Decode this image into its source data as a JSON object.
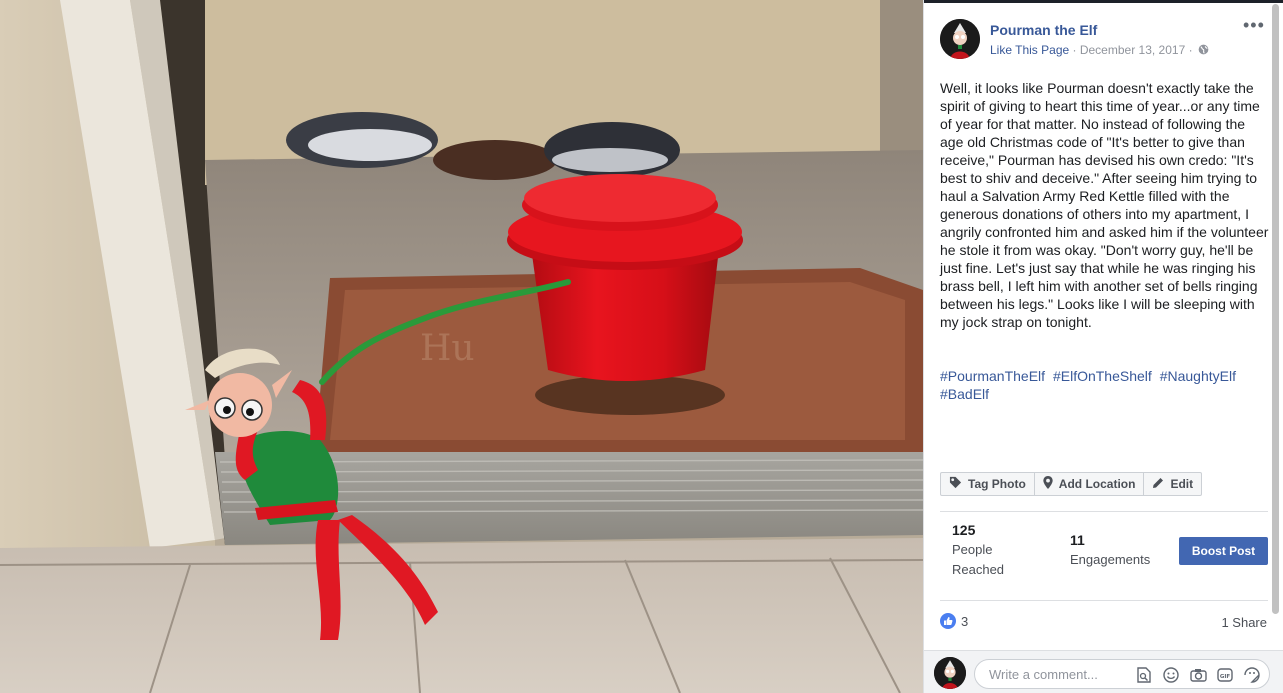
{
  "post": {
    "page_name": "Pourman the Elf",
    "like_page": "Like This Page",
    "separator": " · ",
    "date": "December 13, 2017",
    "date_suffix": " · ",
    "more": "•••",
    "text": "Well, it looks like Pourman doesn't exactly take the spirit of giving to heart this time of year...or any time of year for that matter. No instead of following the age old Christmas code of \"It's better to give than receive,\" Pourman has devised his own credo: \"It's best to shiv and deceive.\" After seeing him trying to haul a Salvation Army Red Kettle filled with the generous donations of others into my apartment, I angrily confronted him and asked him if the volunteer he stole it from was okay. \"Don't worry guy, he'll be just fine. Let's just say that while he was ringing his brass bell, I left him with another set of bells ringing between his legs.\" Looks like I will be sleeping with my jock strap on tonight.",
    "hashtags": [
      "#PourmanTheElf",
      "#ElfOnTheShelf",
      "#NaughtyElf",
      "#BadElf"
    ]
  },
  "actions": {
    "tag_photo": "Tag Photo",
    "add_location": "Add Location",
    "edit": "Edit"
  },
  "stats": {
    "reached_num": "125",
    "reached_label_1": "People",
    "reached_label_2": "Reached",
    "engagements_num": "11",
    "engagements_label": "Engagements",
    "boost": "Boost Post"
  },
  "reactions": {
    "likes": "3",
    "shares": "1 Share"
  },
  "comment": {
    "placeholder": "Write a comment..."
  },
  "icons": {
    "globe": "globe-icon",
    "tag": "tag-icon",
    "location": "location-pin-icon",
    "edit": "pencil-icon",
    "like": "thumbs-up-icon",
    "comment_tools": [
      "sticker-search-icon",
      "emoji-icon",
      "camera-icon",
      "gif-icon",
      "sticker-icon"
    ]
  },
  "colors": {
    "link": "#385898",
    "boost": "#4267b2",
    "like_badge": "#4a7ef0",
    "kettle": "#e0131d"
  }
}
